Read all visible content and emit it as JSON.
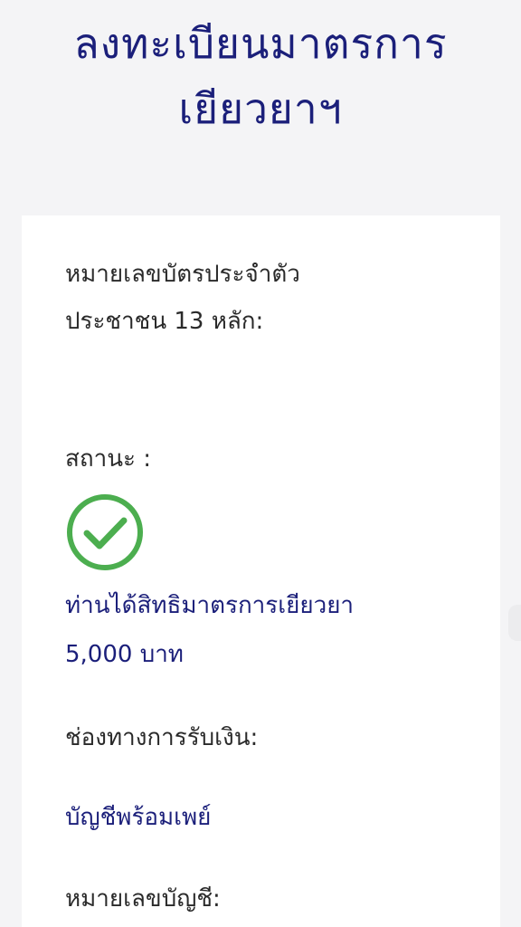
{
  "page": {
    "title_line1": "ลงทะเบียนมาตรการ",
    "title_line2": "เยียวยาฯ"
  },
  "card": {
    "id_label_line1": "หมายเลขบัตรประจำตัว",
    "id_label_line2": "ประชาชน 13 หลัก:",
    "status_label": "สถานะ :",
    "status_icon": "check-circle-icon",
    "status_color": "#4cae4f",
    "entitlement_line1": "ท่านได้สิทธิมาตรการเยียวยา",
    "entitlement_line2": "5,000 บาท",
    "channel_label": "ช่องทางการรับเงิน:",
    "channel_value": "บัญชีพร้อมเพย์",
    "account_label": "หมายเลขบัญชี:"
  },
  "colors": {
    "title": "#1b1f7a",
    "label": "#2a2a2a",
    "value": "#1b1f7a",
    "background": "#f4f4f6",
    "card": "#ffffff"
  }
}
